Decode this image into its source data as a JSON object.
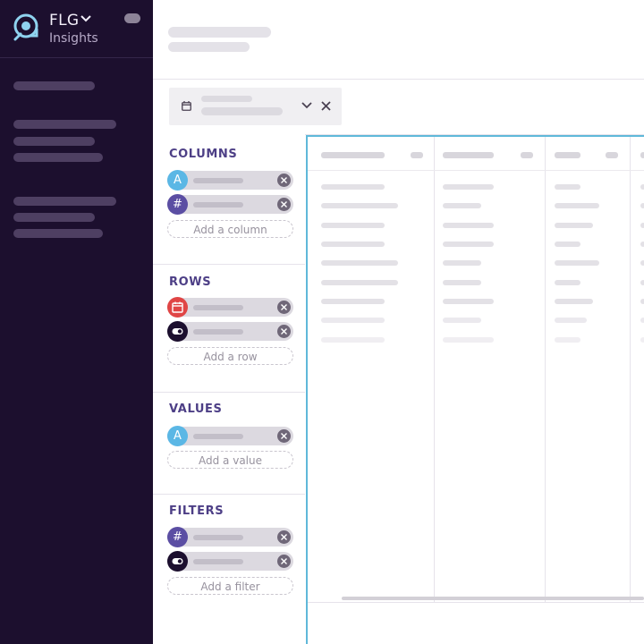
{
  "brand": {
    "name": "FLG",
    "subtitle": "Insights"
  },
  "colors": {
    "sidebar": "#1c0f2e",
    "section_title": "#4d3f86",
    "type_text": "#5bb7e5",
    "type_number": "#5b4ea3",
    "type_date": "#e04545",
    "type_boolean": "#1c0f2e",
    "grid_border": "#5fb8d9"
  },
  "panel": {
    "columns": {
      "title": "COLUMNS",
      "fields": [
        {
          "type_icon": "A",
          "icon": "text-type-icon"
        },
        {
          "type_icon": "#",
          "icon": "number-type-icon"
        }
      ],
      "add_label": "Add a column"
    },
    "rows": {
      "title": "ROWS",
      "fields": [
        {
          "icon": "calendar-type-icon"
        },
        {
          "icon": "toggle-type-icon"
        }
      ],
      "add_label": "Add a row"
    },
    "values": {
      "title": "VALUES",
      "fields": [
        {
          "type_icon": "A",
          "icon": "text-type-icon"
        }
      ],
      "add_label": "Add a value"
    },
    "filters": {
      "title": "FILTERS",
      "fields": [
        {
          "type_icon": "#",
          "icon": "number-type-icon"
        },
        {
          "icon": "toggle-type-icon"
        }
      ],
      "add_label": "Add a filter"
    }
  },
  "date_filter": {
    "icon": "calendar-icon"
  }
}
